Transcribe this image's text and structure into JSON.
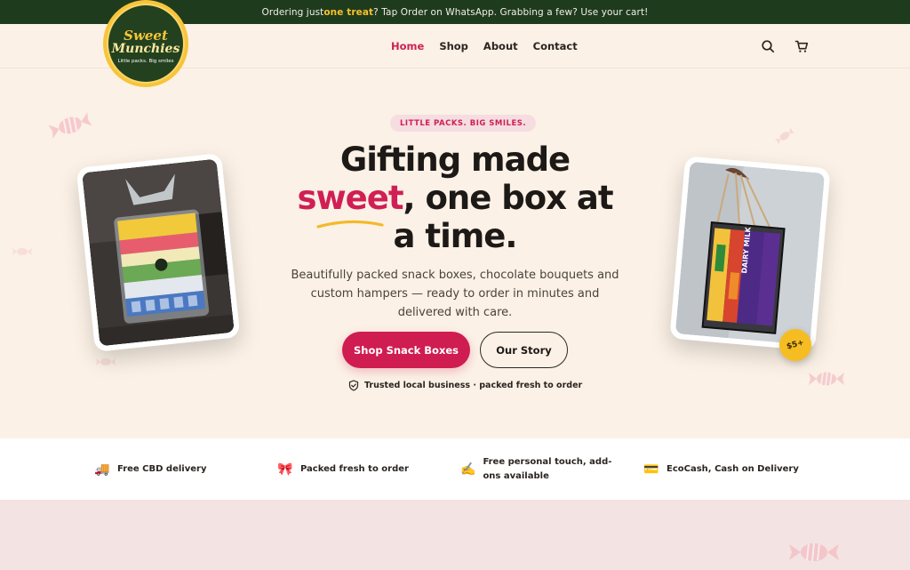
{
  "announcement": {
    "before": "Ordering just ",
    "highlight": "one treat",
    "after": "? Tap Order on WhatsApp. Grabbing a few? Use your cart!"
  },
  "logo": {
    "line1": "Sweet",
    "line2": "Munchies",
    "tagline": "Little packs. Big smiles"
  },
  "nav": {
    "items": [
      "Home",
      "Shop",
      "About",
      "Contact"
    ],
    "active": "Home"
  },
  "header_icons": [
    "search-icon",
    "cart-icon"
  ],
  "hero": {
    "label": "LITTLE PACKS. BIG SMILES.",
    "title_line1": "Gifting made",
    "title_highlight": "sweet",
    "title_line2_rest": ", one box at",
    "title_line3": "a time.",
    "subtitle": "Beautifully packed snack boxes, chocolate bouquets and custom hampers — ready to order in minutes and delivered with care.",
    "primary_button": "Shop Snack Boxes",
    "secondary_button": "Our Story",
    "trust_text": "Trusted local business · packed fresh to order",
    "price_badge": "$5+"
  },
  "features": [
    {
      "icon": "🚚",
      "text": "Free CBD delivery"
    },
    {
      "icon": "🎀",
      "text": "Packed fresh to order"
    },
    {
      "icon": "✍️",
      "text": "Free personal touch, add-ons available"
    },
    {
      "icon": "💳",
      "text": "EcoCash, Cash on Delivery"
    }
  ],
  "colors": {
    "announce_bg": "#1f3b1e",
    "accent": "#d01f55",
    "hero_bg": "#fbf1e6",
    "badge": "#f6bd22"
  }
}
